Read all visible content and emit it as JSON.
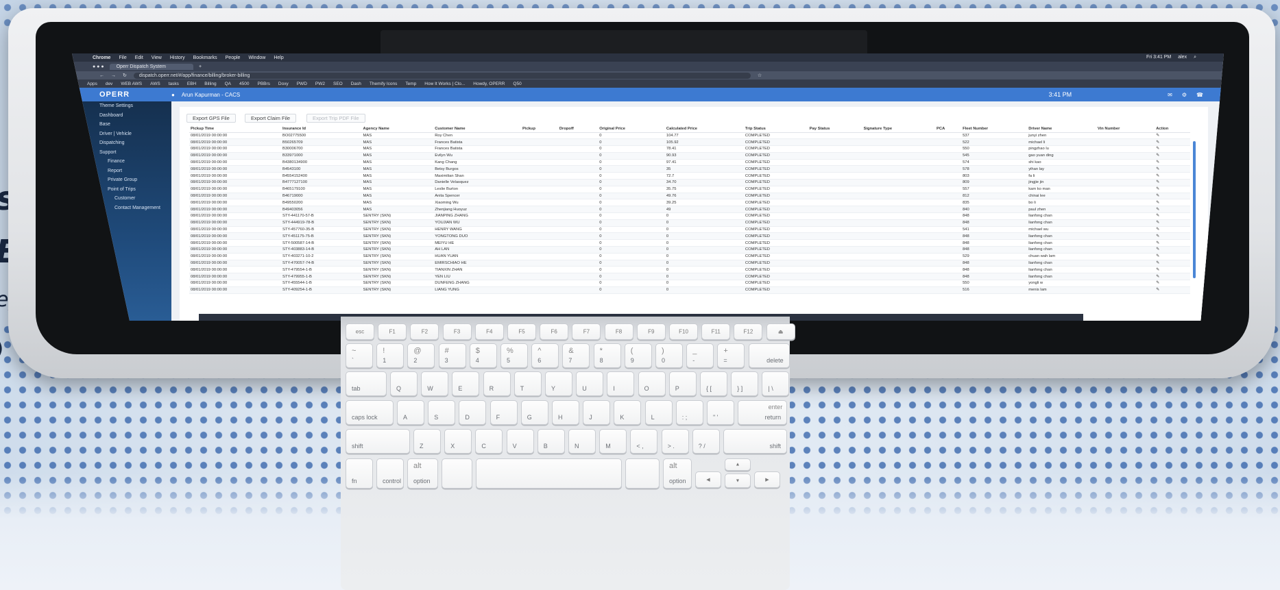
{
  "browser": {
    "menubar": [
      "Chrome",
      "File",
      "Edit",
      "View",
      "History",
      "Bookmarks",
      "People",
      "Window",
      "Help"
    ],
    "clock": "Fri 3:41 PM",
    "account": "alex",
    "tab_title": "Operr Dispatch System",
    "url": "dispatch.operr.net/#/app/finance/billing/broker-billing",
    "bookmarks": [
      "Apps",
      "dev",
      "WEB AWS",
      "AWS",
      "tasks",
      "EBH",
      "Billing",
      "QA",
      "4500",
      "PBBrs",
      "Doxy",
      "PWD",
      "PW2",
      "SEO",
      "Dash",
      "Themify Icons",
      "Temp",
      "How It Works | Clo...",
      "Howdy, OPERR",
      "Q50"
    ]
  },
  "app": {
    "logo": "OPERR",
    "user": "Arun Kapurman - CACS",
    "time": "3:41 PM"
  },
  "sidebar": {
    "items": [
      {
        "label": "Theme Settings",
        "level": 0
      },
      {
        "label": "Dashboard",
        "level": 0
      },
      {
        "label": "Base",
        "level": 0
      },
      {
        "label": "Driver | Vehicle",
        "level": 0
      },
      {
        "label": "Dispatching",
        "level": 0
      },
      {
        "label": "Support",
        "level": 0
      },
      {
        "label": "Finance",
        "level": 1
      },
      {
        "label": "Report",
        "level": 1
      },
      {
        "label": "Private Group",
        "level": 1
      },
      {
        "label": "Point of Trips",
        "level": 1
      },
      {
        "label": "Customer",
        "level": 2
      },
      {
        "label": "Contact Management",
        "level": 2
      }
    ]
  },
  "actions": {
    "export_gps": "Export GPS File",
    "export_claim": "Export Claim File",
    "export_trip_pdf": "Export Trip PDF File"
  },
  "table": {
    "columns": [
      "Pickup Time",
      "Insurance Id",
      "Agency Name",
      "Customer Name",
      "Pickup",
      "Dropoff",
      "Original Price",
      "Calculated Price",
      "Trip Status",
      "Pay Status",
      "Signature Type",
      "PCA",
      "Fleet Number",
      "Driver Name",
      "Vin Number",
      "Action"
    ],
    "rows": [
      [
        "08/01/2019 00:00:00",
        "BO02775500",
        "MAS",
        "Roy Chen",
        "",
        "",
        "0",
        "104.77",
        "COMPLETED",
        "",
        "",
        "",
        "537",
        "junyi zhen",
        "",
        "✎"
      ],
      [
        "08/01/2019 00:00:00",
        "B50265709",
        "MAS",
        "Frances Batista",
        "",
        "",
        "0",
        "105.92",
        "COMPLETED",
        "",
        "",
        "",
        "522",
        "michael li",
        "",
        "✎"
      ],
      [
        "08/01/2019 00:00:00",
        "B30006700",
        "MAS",
        "Frances Batista",
        "",
        "",
        "0",
        "78.41",
        "COMPLETED",
        "",
        "",
        "",
        "550",
        "pingzhao lu",
        "",
        "✎"
      ],
      [
        "08/01/2019 00:00:00",
        "B33971000",
        "MAS",
        "Evilyn Wu",
        "",
        "",
        "0",
        "90.93",
        "COMPLETED",
        "",
        "",
        "",
        "545",
        "gao yuan ding",
        "",
        "✎"
      ],
      [
        "08/01/2019 00:00:00",
        "B4380134900",
        "MAS",
        "Kang Chang",
        "",
        "",
        "0",
        "97.41",
        "COMPLETED",
        "",
        "",
        "",
        "574",
        "shi kao",
        "",
        "✎"
      ],
      [
        "08/01/2019 00:00:00",
        "B4543100",
        "MAS",
        "Betsy Burgos",
        "",
        "",
        "0",
        "35",
        "COMPLETED",
        "",
        "",
        "",
        "578",
        "yihan lay",
        "",
        "✎"
      ],
      [
        "08/01/2019 00:00:00",
        "B4554152400",
        "MAS",
        "Maximilian Shan",
        "",
        "",
        "0",
        "72.7",
        "COMPLETED",
        "",
        "",
        "",
        "803",
        "fa li",
        "",
        "✎"
      ],
      [
        "08/01/2019 00:00:00",
        "B4777127100",
        "MAS",
        "Danielle Velasquez",
        "",
        "",
        "0",
        "34.70",
        "COMPLETED",
        "",
        "",
        "",
        "809",
        "jingjie jin",
        "",
        "✎"
      ],
      [
        "08/01/2019 00:00:00",
        "B465179100",
        "MAS",
        "Leslie Burton",
        "",
        "",
        "0",
        "35.75",
        "COMPLETED",
        "",
        "",
        "",
        "557",
        "kam ko man",
        "",
        "✎"
      ],
      [
        "08/01/2019 00:00:00",
        "B46719000",
        "MAS",
        "Anita Spencer",
        "",
        "",
        "0",
        "49.76",
        "COMPLETED",
        "",
        "",
        "",
        "812",
        "chinai lee",
        "",
        "✎"
      ],
      [
        "08/01/2019 00:00:00",
        "B49550200",
        "MAS",
        "Xiaoming Wu",
        "",
        "",
        "0",
        "39.25",
        "COMPLETED",
        "",
        "",
        "",
        "835",
        "bo li",
        "",
        "✎"
      ],
      [
        "08/01/2019 00:00:00",
        "B49403056",
        "MAS",
        "Zhenjiang Huoyuz",
        "",
        "",
        "0",
        "49",
        "COMPLETED",
        "",
        "",
        "",
        "840",
        "paul zhen",
        "",
        "✎"
      ],
      [
        "08/01/2019 00:00:00",
        "STY-441170-57-B",
        "SENTRY (SKN)",
        "JIANPING ZHANG",
        "",
        "",
        "0",
        "0",
        "COMPLETED",
        "",
        "",
        "",
        "848",
        "lianfong chan",
        "",
        "✎"
      ],
      [
        "08/01/2019 00:00:00",
        "STY-444919-78-B",
        "SENTRY (SKN)",
        "YOUJIAN WU",
        "",
        "",
        "0",
        "0",
        "COMPLETED",
        "",
        "",
        "",
        "848",
        "lianfong chan",
        "",
        "✎"
      ],
      [
        "08/01/2019 00:00:00",
        "STY-457760-35-B",
        "SENTRY (SKN)",
        "HENRY WANG",
        "",
        "",
        "0",
        "0",
        "COMPLETED",
        "",
        "",
        "",
        "541",
        "michael wu",
        "",
        "✎"
      ],
      [
        "08/01/2019 00:00:00",
        "STY-451175-75-B",
        "SENTRY (SKN)",
        "YONGTONG DUO",
        "",
        "",
        "0",
        "0",
        "COMPLETED",
        "",
        "",
        "",
        "848",
        "lianfong chan",
        "",
        "✎"
      ],
      [
        "08/01/2019 00:00:00",
        "STY-500587-14-B",
        "SENTRY (SKN)",
        "MEIYU HE",
        "",
        "",
        "0",
        "0",
        "COMPLETED",
        "",
        "",
        "",
        "848",
        "lianfong chan",
        "",
        "✎"
      ],
      [
        "08/01/2019 00:00:00",
        "STY-403883-14-B",
        "SENTRY (SKN)",
        "AH LAN",
        "",
        "",
        "0",
        "0",
        "COMPLETED",
        "",
        "",
        "",
        "848",
        "lianfong chan",
        "",
        "✎"
      ],
      [
        "08/01/2019 00:00:00",
        "STY-403271-10-2",
        "SENTRY (SKN)",
        "HUAN YUAN",
        "",
        "",
        "0",
        "0",
        "COMPLETED",
        "",
        "",
        "",
        "529",
        "chuan wah lam",
        "",
        "✎"
      ],
      [
        "08/01/2019 00:00:00",
        "STY-470057-74-B",
        "SENTRY (SKN)",
        "EMIRSCHIAO HE",
        "",
        "",
        "0",
        "0",
        "COMPLETED",
        "",
        "",
        "",
        "848",
        "lianfong chan",
        "",
        "✎"
      ],
      [
        "08/01/2019 00:00:00",
        "STY-479554-1-B",
        "SENTRY (SKN)",
        "TIANXIN ZHAN",
        "",
        "",
        "0",
        "0",
        "COMPLETED",
        "",
        "",
        "",
        "848",
        "lianfong chan",
        "",
        "✎"
      ],
      [
        "08/01/2019 00:00:00",
        "STY-479955-1-B",
        "SENTRY (SKN)",
        "YEN LIU",
        "",
        "",
        "0",
        "0",
        "COMPLETED",
        "",
        "",
        "",
        "848",
        "lianfong chan",
        "",
        "✎"
      ],
      [
        "08/01/2019 00:00:00",
        "STY-455544-1-B",
        "SENTRY (SKN)",
        "DUNFENG ZHANG",
        "",
        "",
        "0",
        "0",
        "COMPLETED",
        "",
        "",
        "",
        "550",
        "yongli w",
        "",
        "✎"
      ],
      [
        "08/01/2019 00:00:00",
        "STY-409254-1-B",
        "SENTRY (SKN)",
        "LIANG YUNG",
        "",
        "",
        "0",
        "0",
        "COMPLETED",
        "",
        "",
        "",
        "516",
        "menis lam",
        "",
        "✎"
      ]
    ]
  },
  "keyboard": {
    "row0": [
      "esc",
      "F1",
      "F2",
      "F3",
      "F4",
      "F5",
      "F6",
      "F7",
      "F8",
      "F9",
      "F10",
      "F11",
      "F12",
      "⏏"
    ],
    "row1": [
      {
        "top": "~",
        "bot": "`"
      },
      {
        "top": "!",
        "bot": "1"
      },
      {
        "top": "@",
        "bot": "2"
      },
      {
        "top": "#",
        "bot": "3"
      },
      {
        "top": "$",
        "bot": "4"
      },
      {
        "top": "%",
        "bot": "5"
      },
      {
        "top": "^",
        "bot": "6"
      },
      {
        "top": "&",
        "bot": "7"
      },
      {
        "top": "*",
        "bot": "8"
      },
      {
        "top": "(",
        "bot": "9"
      },
      {
        "top": ")",
        "bot": "0"
      },
      {
        "top": "_",
        "bot": "-"
      },
      {
        "top": "+",
        "bot": "="
      }
    ],
    "delete": "delete",
    "tab": "tab",
    "row2": [
      "Q",
      "W",
      "E",
      "R",
      "T",
      "Y",
      "U",
      "I",
      "O",
      "P",
      "{ [",
      "} ]",
      "| \\"
    ],
    "caps": "caps lock",
    "row3": [
      "A",
      "S",
      "D",
      "F",
      "G",
      "H",
      "J",
      "K",
      "L",
      ": ;",
      "\" '"
    ],
    "enter": "enter",
    "return": "return",
    "shift_left": "shift",
    "row4": [
      "Z",
      "X",
      "C",
      "V",
      "B",
      "N",
      "M",
      "< ,",
      "> .",
      "? /"
    ],
    "shift_right": "shift",
    "fn": "fn",
    "control": "control",
    "alt": "alt",
    "option": "option",
    "option_right": "option",
    "alt_right": "alt"
  }
}
